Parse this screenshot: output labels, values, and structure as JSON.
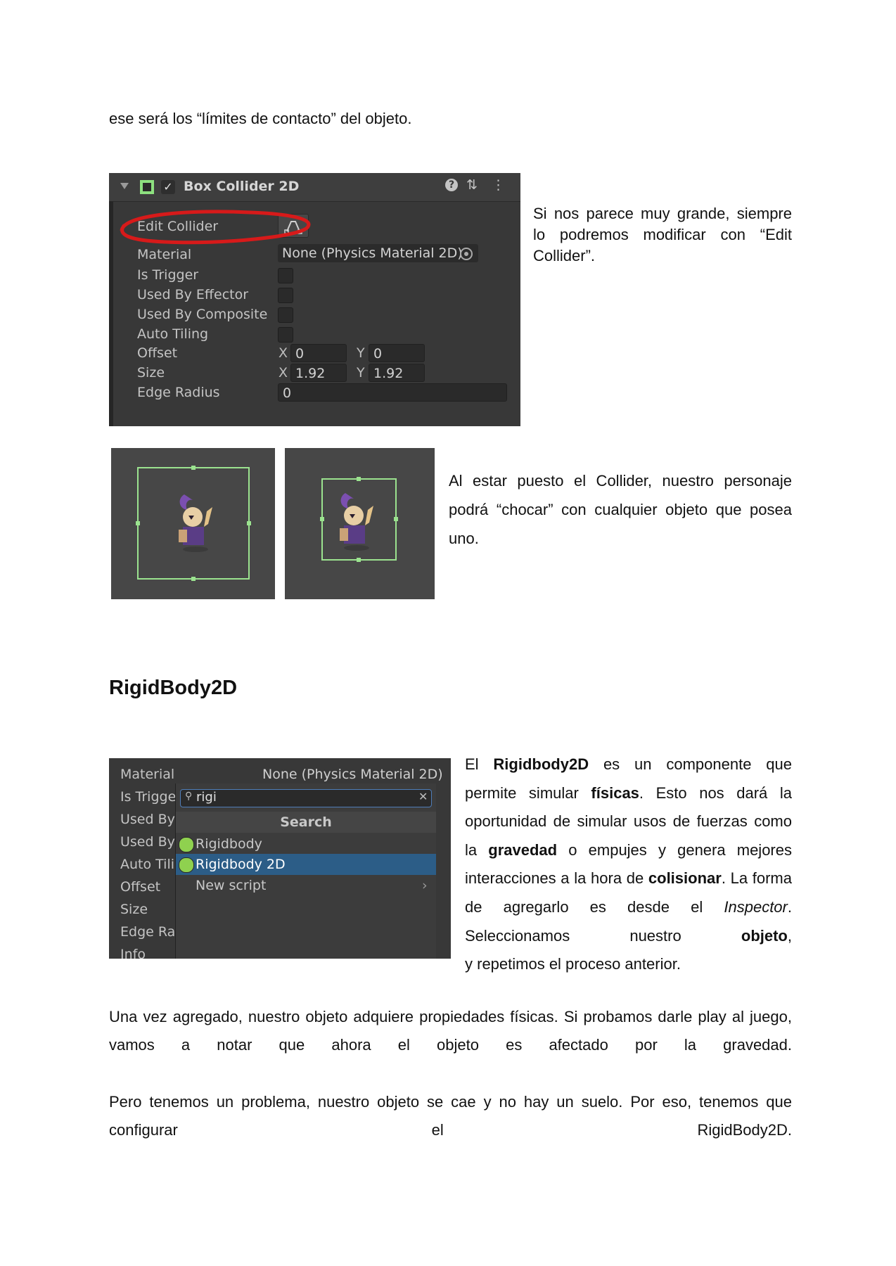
{
  "intro_line": "ese será los “límites de contacto” del objeto.",
  "collider_panel": {
    "title": "Box Collider 2D",
    "edit_label": "Edit Collider",
    "rows": [
      "Material",
      "Is Trigger",
      "Used By Effector",
      "Used By Composite",
      "Auto Tiling",
      "Offset",
      "Size",
      "Edge Radius"
    ],
    "material_value": "None (Physics Material 2D)",
    "offset_x": "0",
    "offset_y": "0",
    "size_x": "1.92",
    "size_y": "1.92",
    "edge_radius": "0",
    "axis_x": "X",
    "axis_y": "Y"
  },
  "para_edit": "Si nos parece muy grande, siempre lo podremos modificar con “Edit Collider”.",
  "para_collider": "Al estar puesto el Collider, nuestro personaje podrá “chocar” con cualquier objeto que posea uno.",
  "heading_rigidbody": "RigidBody2D",
  "add_panel": {
    "labels": [
      "Material",
      "Is Trigge",
      "Used By",
      "Used By",
      "Auto Tili",
      "Offset",
      "Size",
      "Edge Ra",
      "Info"
    ],
    "material_value": "None (Physics Material 2D)",
    "search_text": "rigi",
    "search_header": "Search",
    "items": [
      "Rigidbody",
      "Rigidbody 2D",
      "New script"
    ]
  },
  "para_rb": {
    "t1": "El ",
    "b1": "Rigidbody2D",
    "t2": " es un componente que permite simular ",
    "b2": "físicas",
    "t3": ". Esto nos dará la oportunidad de simular usos de fuerzas como la ",
    "b3": "gravedad",
    "t4": " o empujes y genera mejores interacciones a la hora de ",
    "b4": "colisionar",
    "t5": ". La forma de agregarlo es desde el ",
    "i1": "Inspector",
    "t6": ". Seleccionamos nuestro ",
    "b5": "objeto",
    "t7": ","
  },
  "para_rb_last": "y repetimos el proceso anterior.",
  "para_added": "Una vez agregado, nuestro objeto adquiere propiedades físicas. Si probamos darle play al juego, vamos a notar que ahora el objeto es afectado por la gravedad.",
  "para_problem": "Pero tenemos un problema, nuestro objeto se cae y no hay un suelo. Por eso, tenemos que configurar el RigidBody2D."
}
